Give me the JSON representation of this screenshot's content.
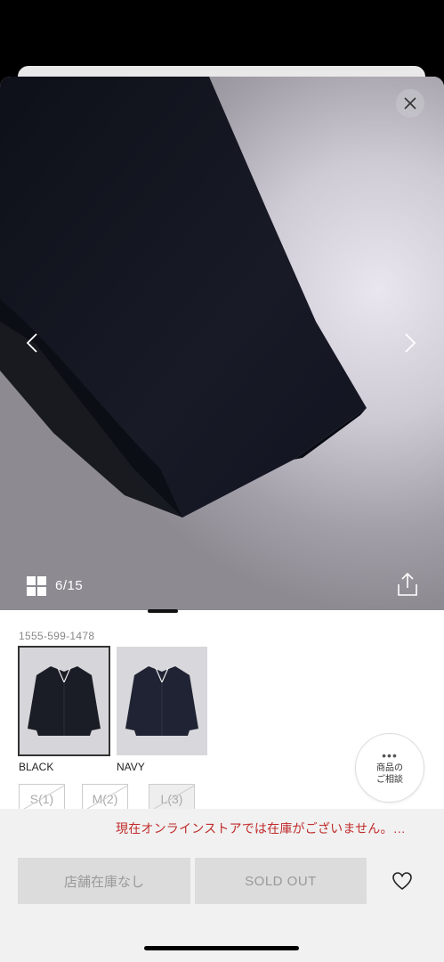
{
  "gallery": {
    "counter": "6/15",
    "close_icon": "close-icon",
    "prev_icon": "chevron-left-icon",
    "next_icon": "chevron-right-icon",
    "grid_icon": "grid-icon",
    "share_icon": "share-icon"
  },
  "product": {
    "id": "1555-599-1478",
    "colors": [
      {
        "label": "BLACK",
        "selected": true,
        "tone": "#1b1d26"
      },
      {
        "label": "NAVY",
        "selected": false,
        "tone": "#1f2333"
      }
    ],
    "sizes": [
      "S(1)",
      "M(2)",
      "L(3)"
    ]
  },
  "consult": {
    "dots": "•••",
    "line1": "商品の",
    "line2": "ご相談"
  },
  "footer": {
    "stock_message": "現在オンラインストアでは在庫がございません。…",
    "store_button": "店舗在庫なし",
    "soldout_button": "SOLD OUT",
    "favorite_icon": "heart-icon"
  },
  "colors": {
    "alert": "#c12a2a",
    "disabled_button": "#dcdcdc",
    "garment": "#161822"
  }
}
